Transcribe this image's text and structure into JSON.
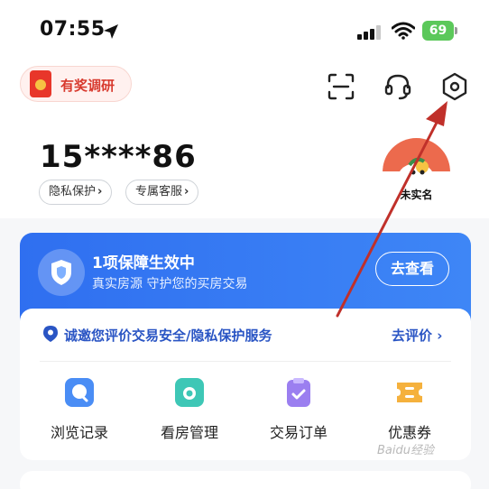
{
  "status_bar": {
    "time": "07:55",
    "battery": "69"
  },
  "header": {
    "survey_label": "有奖调研",
    "icons": [
      "scan-icon",
      "customer-service-icon",
      "settings-icon"
    ]
  },
  "user": {
    "phone": "15****86",
    "privacy_chip": "隐私保护",
    "service_chip": "专属客服",
    "avatar_label": "未实名"
  },
  "guarantee_card": {
    "title": "1项保障生效中",
    "subtitle": "真实房源 守护您的买房交易",
    "button": "去查看"
  },
  "evaluation": {
    "text": "诚邀您评价交易安全/隐私保护服务",
    "link": "去评价"
  },
  "menu": [
    {
      "label": "浏览记录",
      "icon": "browse-history-icon"
    },
    {
      "label": "看房管理",
      "icon": "viewing-management-icon"
    },
    {
      "label": "交易订单",
      "icon": "orders-icon"
    },
    {
      "label": "优惠券",
      "icon": "coupon-icon"
    }
  ],
  "watermark": "Baidu经验",
  "colors": {
    "accent": "#2f6ff0",
    "red": "#e8362a",
    "link": "#2a55c4"
  }
}
